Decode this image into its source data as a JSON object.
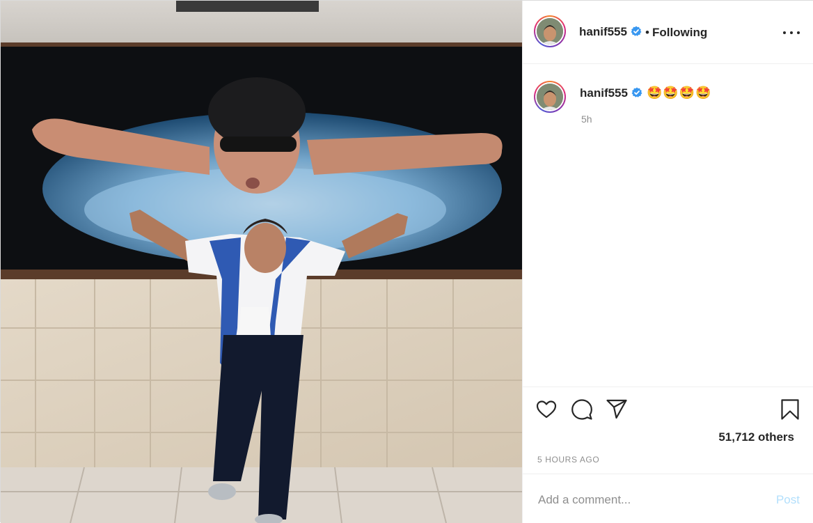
{
  "post": {
    "username": "hanif555",
    "verified": true,
    "follow_status": "Following",
    "caption_emojis": "🤩🤩🤩🤩",
    "caption_time": "5h",
    "likes_text": "51,712 others",
    "posted_ago": "5 HOURS AGO",
    "comment_placeholder": "Add a comment...",
    "post_button": "Post"
  },
  "colors": {
    "verified_blue": "#3897f0",
    "post_button_disabled": "#b2dffc",
    "secondary_text": "#8e8e8e"
  },
  "icons": {
    "like": "heart-icon",
    "comment": "comment-icon",
    "share": "paper-plane-icon",
    "save": "bookmark-icon",
    "more": "more-options-icon"
  }
}
